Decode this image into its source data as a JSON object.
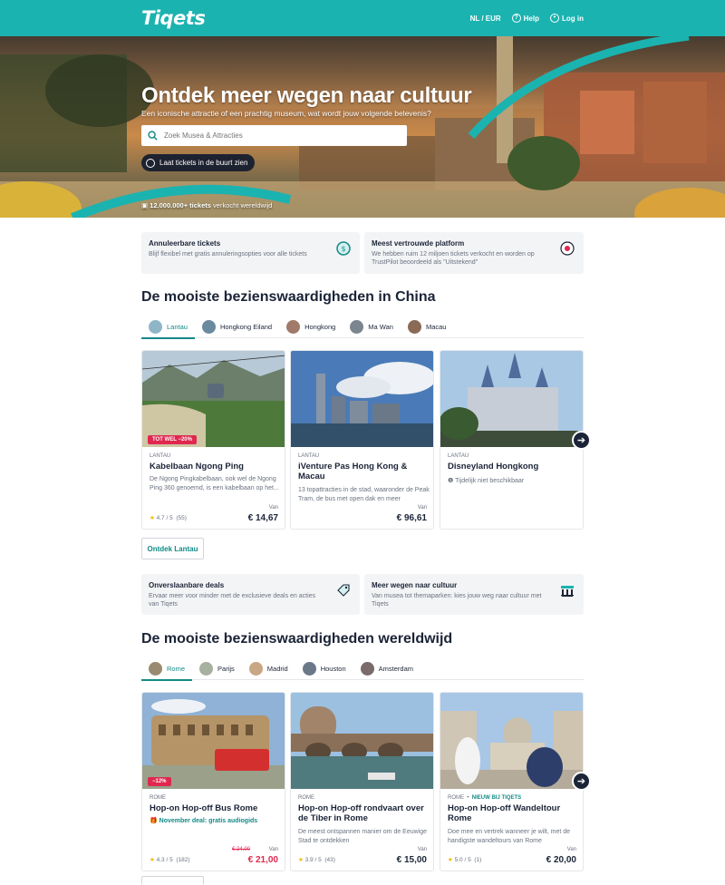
{
  "header": {
    "logo": "Tiqets",
    "lang_currency": "NL / EUR",
    "help": "Help",
    "login": "Log in"
  },
  "hero": {
    "title": "Ontdek meer wegen naar cultuur",
    "subtitle": "Een iconische attractie of een prachtig museum, wat wordt jouw volgende belevenis?",
    "search_placeholder": "Zoek Musea & Attracties",
    "near_button": "Laat tickets in de buurt zien",
    "sold_count": "12.000.000+ tickets",
    "sold_suffix": "verkocht wereldwijd"
  },
  "usp_top": [
    {
      "title": "Annuleerbare tickets",
      "desc": "Blijf flexibel met gratis annuleringsopties voor alle tickets",
      "icon": "refund-icon"
    },
    {
      "title": "Meest vertrouwde platform",
      "desc": "We hebben ruim 12 miljoen tickets verkocht en worden op TrustPilot beoordeeld als \"Uitstekend\"",
      "icon": "award-icon"
    }
  ],
  "china": {
    "heading": "De mooiste bezienswaardigheden in China",
    "tabs": [
      "Lantau",
      "Hongkong Eiland",
      "Hongkong",
      "Ma Wan",
      "Macau"
    ],
    "cards": [
      {
        "badge": "TOT WEL −20%",
        "location": "LANTAU",
        "name": "Kabelbaan Ngong Ping",
        "desc": "De Ngong Pingkabelbaan, ook wel de Ngong Ping 360 genoemd, is een kabelbaan op het...",
        "rating": "4.7 / 5",
        "reviews": "(55)",
        "van": "Van",
        "price": "€ 14,67"
      },
      {
        "location": "LANTAU",
        "name": "iVenture Pas Hong Kong & Macau",
        "desc": "13 topattracties in de stad, waaronder de Peak Tram, de bus met open dak en meer",
        "van": "Van",
        "price": "€ 96,61"
      },
      {
        "location": "LANTAU",
        "name": "Disneyland Hongkong",
        "unavailable": "Tijdelijk niet beschikbaar"
      }
    ],
    "explore_button": "Ontdek Lantau"
  },
  "usp_mid": [
    {
      "title": "Onverslaanbare deals",
      "desc": "Ervaar meer voor minder met de exclusieve deals en acties van Tiqets",
      "icon": "tag-icon"
    },
    {
      "title": "Meer wegen naar cultuur",
      "desc": "Van musea tot themaparken: kies jouw weg naar cultuur met Tiqets",
      "icon": "museum-icon"
    }
  ],
  "world": {
    "heading": "De mooiste bezienswaardigheden wereldwijd",
    "tabs": [
      "Rome",
      "Parijs",
      "Madrid",
      "Houston",
      "Amsterdam"
    ],
    "cards": [
      {
        "badge": "−12%",
        "location": "ROME",
        "name": "Hop-on Hop-off Bus Rome",
        "deal": "November deal: gratis audiogids",
        "rating": "4.3 / 5",
        "reviews": "(182)",
        "van": "Van",
        "old_price": "€ 24,00",
        "price": "€ 21,00"
      },
      {
        "location": "ROME",
        "name": "Hop-on Hop-off rondvaart over de Tiber in Rome",
        "desc": "De meest ontspannen manier om de Eeuwige Stad te ontdekken",
        "rating": "3.9 / 5",
        "reviews": "(43)",
        "van": "Van",
        "price": "€ 15,00"
      },
      {
        "location": "ROME",
        "new_tag": "NIEUW BIJ TIQETS",
        "name": "Hop-on Hop-off Wandeltour Rome",
        "desc": "Doe mee en vertrek wanneer je wilt, met de handigste wandeltours van Rome",
        "rating": "5.0 / 5",
        "reviews": "(1)",
        "van": "Van",
        "price": "€ 20,00"
      }
    ]
  },
  "colors": {
    "brand": "#1bb3b0",
    "accent": "#138a87",
    "sale": "#e0284f",
    "dark": "#1b2437"
  }
}
